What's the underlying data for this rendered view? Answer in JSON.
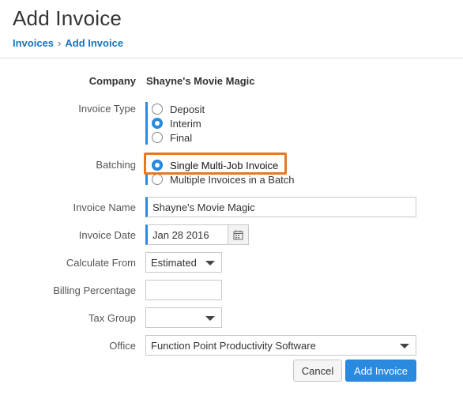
{
  "header": {
    "title": "Add Invoice",
    "breadcrumb": [
      "Invoices",
      "Add Invoice"
    ],
    "breadcrumb_separator": "›"
  },
  "form": {
    "company": {
      "label": "Company",
      "value": "Shayne's Movie Magic"
    },
    "invoice_type": {
      "label": "Invoice Type",
      "options": [
        "Deposit",
        "Interim",
        "Final"
      ],
      "selected": "Interim"
    },
    "batching": {
      "label": "Batching",
      "options": [
        "Single Multi-Job Invoice",
        "Multiple Invoices in a Batch"
      ],
      "selected": "Single Multi-Job Invoice"
    },
    "invoice_name": {
      "label": "Invoice Name",
      "value": "Shayne's Movie Magic"
    },
    "invoice_date": {
      "label": "Invoice Date",
      "value": "Jan 28 2016"
    },
    "calculate_from": {
      "label": "Calculate From",
      "value": "Estimated"
    },
    "billing_percentage": {
      "label": "Billing Percentage",
      "value": ""
    },
    "tax_group": {
      "label": "Tax Group",
      "value": ""
    },
    "office": {
      "label": "Office",
      "value": "Function Point Productivity Software"
    }
  },
  "actions": {
    "cancel_label": "Cancel",
    "submit_label": "Add Invoice"
  },
  "colors": {
    "accent": "#2a8ae0",
    "highlight": "#e8771f",
    "link": "#1a73b8"
  }
}
